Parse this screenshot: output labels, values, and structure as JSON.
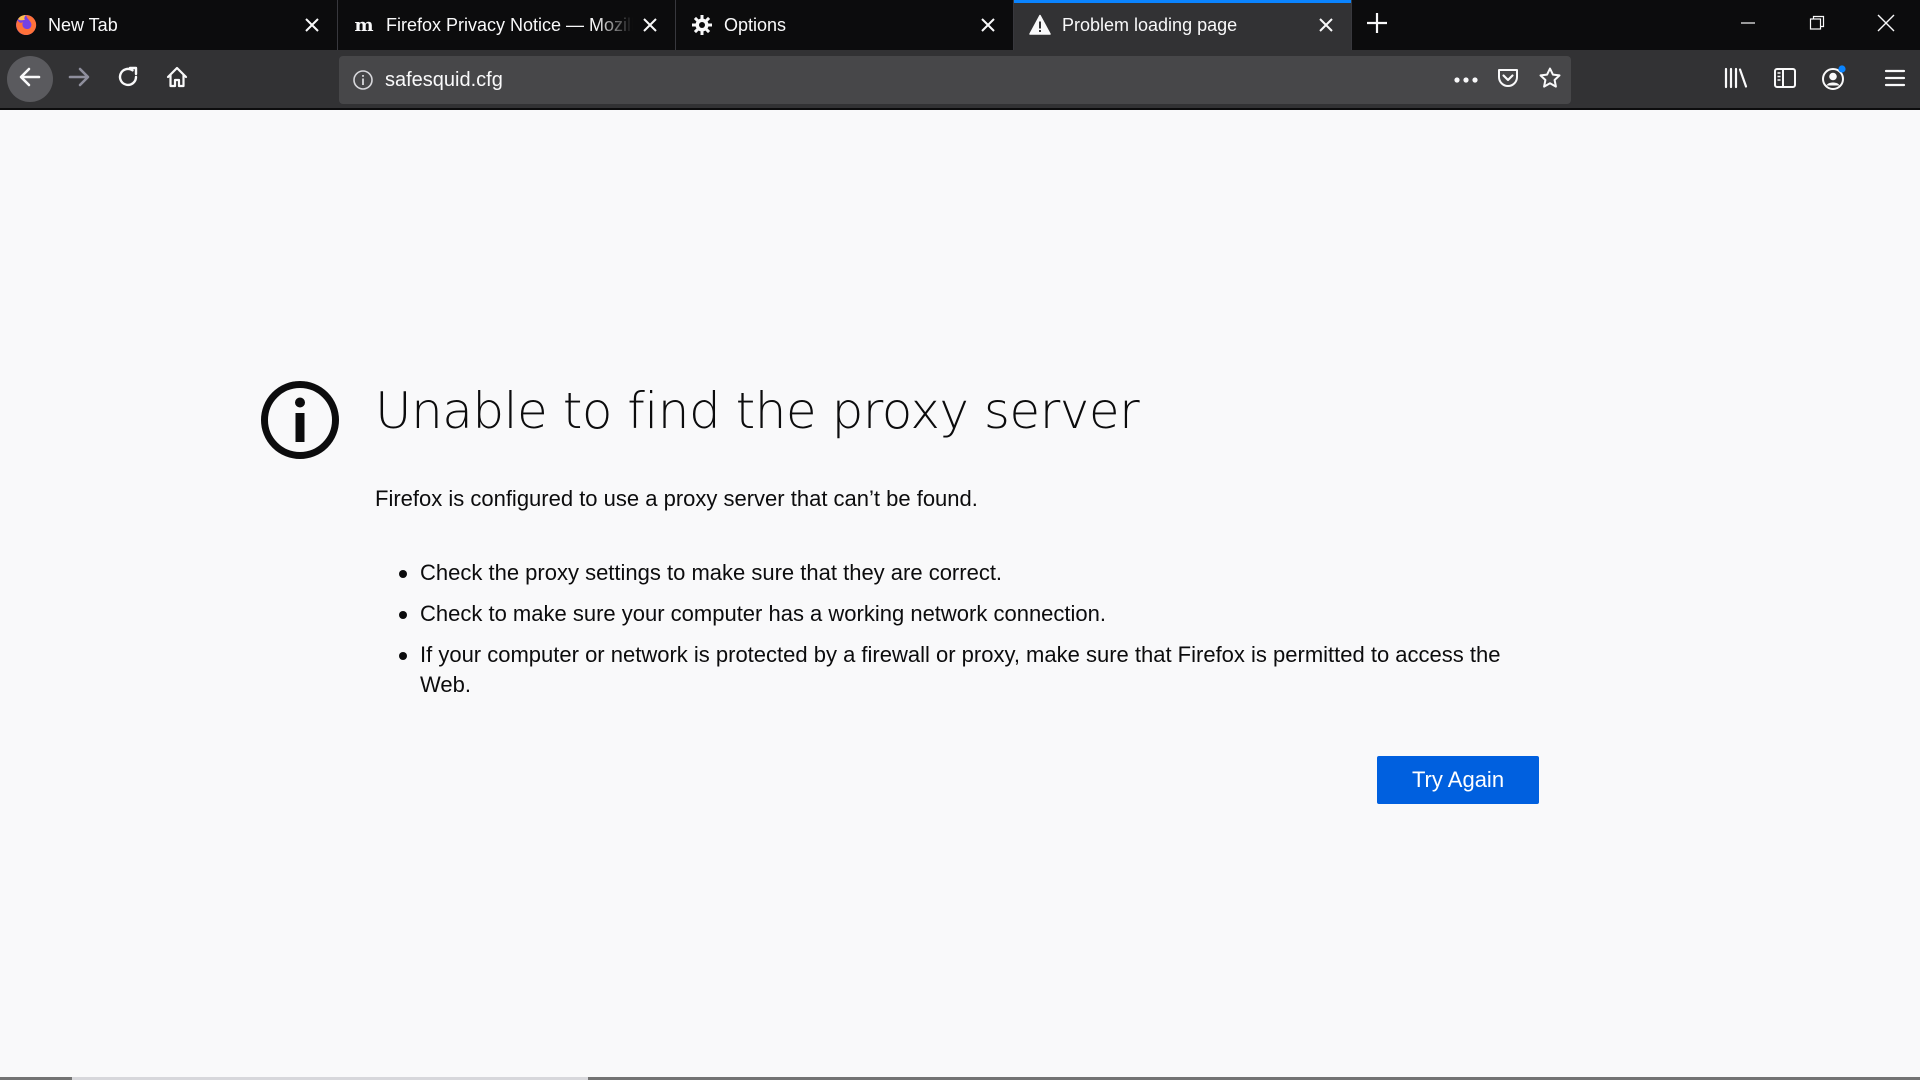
{
  "tabs": [
    {
      "title": "New Tab",
      "icon": "firefox-logo-icon",
      "selected": false
    },
    {
      "title": "Firefox Privacy Notice — Mozilla",
      "icon": "mozilla-m-icon",
      "selected": false
    },
    {
      "title": "Options",
      "icon": "gear-icon",
      "selected": false
    },
    {
      "title": "Problem loading page",
      "icon": "warning-icon",
      "selected": true
    }
  ],
  "urlbar": {
    "url": "safesquid.cfg"
  },
  "error": {
    "title": "Unable to find the proxy server",
    "description": "Firefox is configured to use a proxy server that can’t be found.",
    "items": [
      "Check the proxy settings to make sure that they are correct.",
      "Check to make sure your computer has a working network connection.",
      "If your computer or network is protected by a firewall or proxy, make sure that Firefox is permitted to access the Web."
    ],
    "button_label": "Try Again"
  },
  "colors": {
    "accent": "#0a84ff",
    "button": "#0060df",
    "toolbar": "#323234",
    "tabstrip": "#0c0c0d"
  }
}
